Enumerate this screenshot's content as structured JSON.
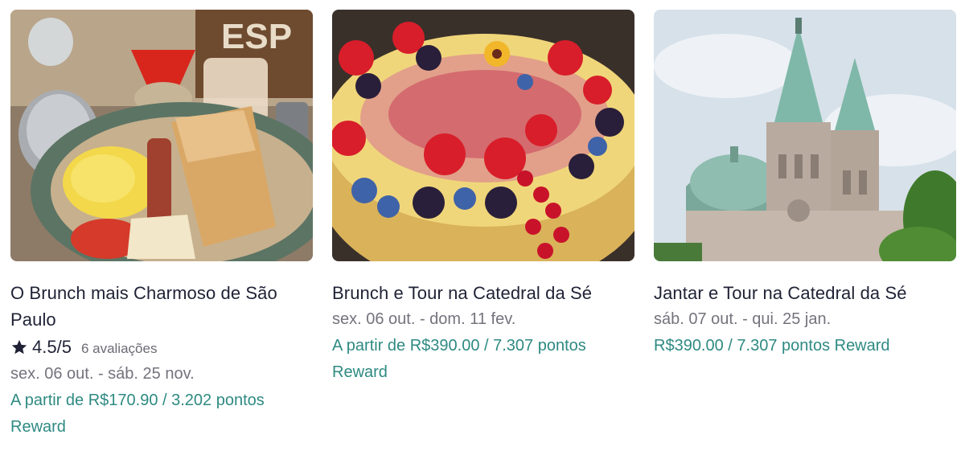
{
  "cards": [
    {
      "image": "brunch-breakfast-plate",
      "title": "O Brunch mais Charmoso de São Paulo",
      "rating": {
        "value": "4.5/5",
        "reviews": "6 avaliações",
        "icon": "star-icon"
      },
      "dates": "sex. 06 out. - sáb. 25 nov.",
      "price": "A partir de R$170.90 / 3.202 pontos Reward"
    },
    {
      "image": "berry-cheesecake",
      "title": "Brunch e Tour na Catedral da Sé",
      "dates": "sex. 06 out. - dom. 11 fev.",
      "price": "A partir de R$390.00 / 7.307 pontos Reward"
    },
    {
      "image": "se-cathedral",
      "title": "Jantar e Tour na Catedral da Sé",
      "dates": "sáb. 07 out. - qui. 25 jan.",
      "price": "R$390.00 / 7.307 pontos Reward"
    }
  ],
  "image_sign_text": "ESP",
  "colors": {
    "title": "#1f2235",
    "muted": "#73737d",
    "price": "#2e8a82",
    "star": "#1f2235"
  }
}
